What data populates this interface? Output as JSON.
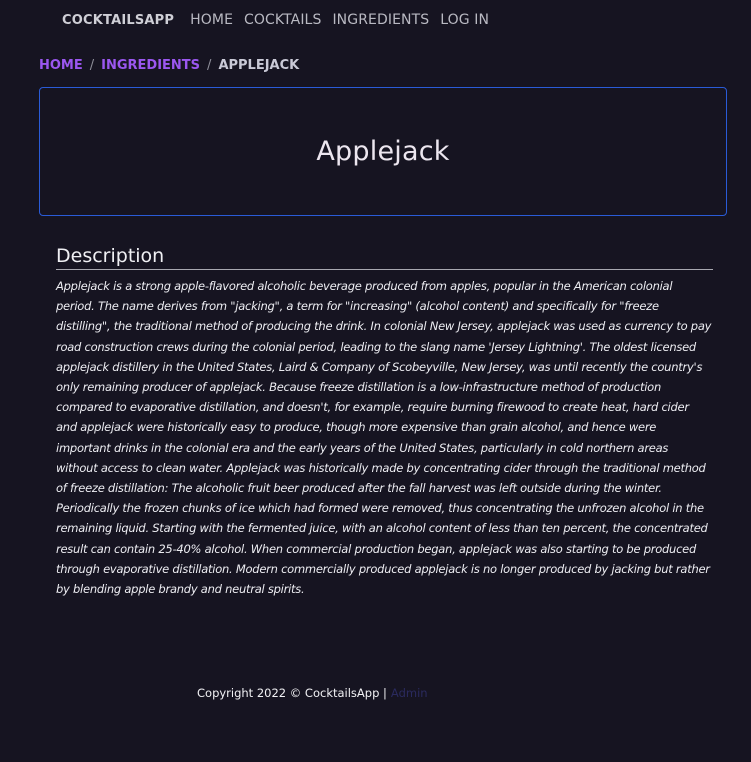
{
  "navbar": {
    "brand": "COCKTAILSAPP",
    "links": [
      "HOME",
      "COCKTAILS",
      "INGREDIENTS",
      "LOG IN"
    ]
  },
  "breadcrumb": {
    "home": "HOME",
    "ingredients": "INGREDIENTS",
    "current": "APPLEJACK",
    "separator": "/"
  },
  "ingredient": {
    "name": "Applejack"
  },
  "description": {
    "heading": "Description",
    "text": "Applejack is a strong apple-flavored alcoholic beverage produced from apples, popular in the American colonial period. The name derives from \"jacking\", a term for \"increasing\" (alcohol content) and specifically for \"freeze distilling\", the traditional method of producing the drink. In colonial New Jersey, applejack was used as currency to pay road construction crews during the colonial period, leading to the slang name 'Jersey Lightning'. The oldest licensed applejack distillery in the United States, Laird & Company of Scobeyville, New Jersey, was until recently the country's only remaining producer of applejack. Because freeze distillation is a low-infrastructure method of production compared to evaporative distillation, and doesn't, for example, require burning firewood to create heat, hard cider and applejack were historically easy to produce, though more expensive than grain alcohol, and hence were important drinks in the colonial era and the early years of the United States, particularly in cold northern areas without access to clean water. Applejack was historically made by concentrating cider through the traditional method of freeze distillation: The alcoholic fruit beer produced after the fall harvest was left outside during the winter. Periodically the frozen chunks of ice which had formed were removed, thus concentrating the unfrozen alcohol in the remaining liquid. Starting with the fermented juice, with an alcohol content of less than ten percent, the concentrated result can contain 25-40% alcohol. When commercial production began, applejack was also starting to be produced through evaporative distillation. Modern commercially produced applejack is no longer produced by jacking but rather by blending apple brandy and neutral spirits."
  },
  "footer": {
    "copyright": "Copyright 2022 © CocktailsApp |",
    "admin_link": "Admin"
  },
  "colors": {
    "background": "#161421",
    "breadcrumb_link": "#9b57f0",
    "card_border": "#2a5bd7",
    "admin_link": "#2a2a5e"
  }
}
